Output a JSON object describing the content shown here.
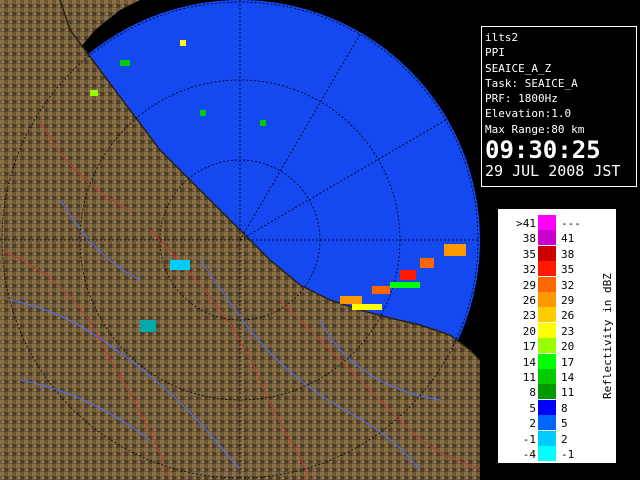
{
  "info": {
    "site": "ilts2",
    "scan_type": "PPI",
    "product": "SEAICE_A_Z",
    "task": "Task: SEAICE_A",
    "prf": "PRF: 1800Hz",
    "elevation": "Elevation:1.0",
    "max_range": "Max Range:80 km",
    "time": "09:30:25",
    "date": "29 JUL 2008 JST"
  },
  "legend": {
    "title": "Reflectivity in dBZ",
    "rows": [
      {
        "left": ">41",
        "right": "---",
        "color": "#ff00ff"
      },
      {
        "left": "38",
        "right": "41",
        "color": "#cc00cc"
      },
      {
        "left": "35",
        "right": "38",
        "color": "#cc0000"
      },
      {
        "left": "32",
        "right": "35",
        "color": "#ff1a00"
      },
      {
        "left": "29",
        "right": "32",
        "color": "#ff6600"
      },
      {
        "left": "26",
        "right": "29",
        "color": "#ff9900"
      },
      {
        "left": "23",
        "right": "26",
        "color": "#ffcc00"
      },
      {
        "left": "20",
        "right": "23",
        "color": "#ffff00"
      },
      {
        "left": "17",
        "right": "20",
        "color": "#99ff00"
      },
      {
        "left": "14",
        "right": "17",
        "color": "#00ff00"
      },
      {
        "left": "11",
        "right": "14",
        "color": "#00cc00"
      },
      {
        "left": "8",
        "right": "11",
        "color": "#009900"
      },
      {
        "left": "5",
        "right": "8",
        "color": "#0000ff"
      },
      {
        "left": "2",
        "right": "5",
        "color": "#0066ff"
      },
      {
        "left": "-1",
        "right": "2",
        "color": "#00ccff"
      },
      {
        "left": "-4",
        "right": "-1",
        "color": "#00ffff"
      }
    ]
  },
  "colors": {
    "sea_echo": "#1a50ff",
    "land_dark": "#5a4a30",
    "land_light": "#a08050",
    "background": "#000000"
  }
}
